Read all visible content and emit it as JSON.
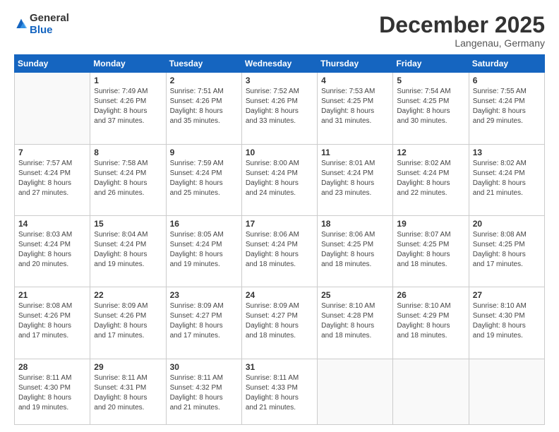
{
  "header": {
    "logo_general": "General",
    "logo_blue": "Blue",
    "month_title": "December 2025",
    "location": "Langenau, Germany"
  },
  "days_of_week": [
    "Sunday",
    "Monday",
    "Tuesday",
    "Wednesday",
    "Thursday",
    "Friday",
    "Saturday"
  ],
  "weeks": [
    [
      {
        "day": "",
        "info": ""
      },
      {
        "day": "1",
        "info": "Sunrise: 7:49 AM\nSunset: 4:26 PM\nDaylight: 8 hours\nand 37 minutes."
      },
      {
        "day": "2",
        "info": "Sunrise: 7:51 AM\nSunset: 4:26 PM\nDaylight: 8 hours\nand 35 minutes."
      },
      {
        "day": "3",
        "info": "Sunrise: 7:52 AM\nSunset: 4:26 PM\nDaylight: 8 hours\nand 33 minutes."
      },
      {
        "day": "4",
        "info": "Sunrise: 7:53 AM\nSunset: 4:25 PM\nDaylight: 8 hours\nand 31 minutes."
      },
      {
        "day": "5",
        "info": "Sunrise: 7:54 AM\nSunset: 4:25 PM\nDaylight: 8 hours\nand 30 minutes."
      },
      {
        "day": "6",
        "info": "Sunrise: 7:55 AM\nSunset: 4:24 PM\nDaylight: 8 hours\nand 29 minutes."
      }
    ],
    [
      {
        "day": "7",
        "info": "Sunrise: 7:57 AM\nSunset: 4:24 PM\nDaylight: 8 hours\nand 27 minutes."
      },
      {
        "day": "8",
        "info": "Sunrise: 7:58 AM\nSunset: 4:24 PM\nDaylight: 8 hours\nand 26 minutes."
      },
      {
        "day": "9",
        "info": "Sunrise: 7:59 AM\nSunset: 4:24 PM\nDaylight: 8 hours\nand 25 minutes."
      },
      {
        "day": "10",
        "info": "Sunrise: 8:00 AM\nSunset: 4:24 PM\nDaylight: 8 hours\nand 24 minutes."
      },
      {
        "day": "11",
        "info": "Sunrise: 8:01 AM\nSunset: 4:24 PM\nDaylight: 8 hours\nand 23 minutes."
      },
      {
        "day": "12",
        "info": "Sunrise: 8:02 AM\nSunset: 4:24 PM\nDaylight: 8 hours\nand 22 minutes."
      },
      {
        "day": "13",
        "info": "Sunrise: 8:02 AM\nSunset: 4:24 PM\nDaylight: 8 hours\nand 21 minutes."
      }
    ],
    [
      {
        "day": "14",
        "info": "Sunrise: 8:03 AM\nSunset: 4:24 PM\nDaylight: 8 hours\nand 20 minutes."
      },
      {
        "day": "15",
        "info": "Sunrise: 8:04 AM\nSunset: 4:24 PM\nDaylight: 8 hours\nand 19 minutes."
      },
      {
        "day": "16",
        "info": "Sunrise: 8:05 AM\nSunset: 4:24 PM\nDaylight: 8 hours\nand 19 minutes."
      },
      {
        "day": "17",
        "info": "Sunrise: 8:06 AM\nSunset: 4:24 PM\nDaylight: 8 hours\nand 18 minutes."
      },
      {
        "day": "18",
        "info": "Sunrise: 8:06 AM\nSunset: 4:25 PM\nDaylight: 8 hours\nand 18 minutes."
      },
      {
        "day": "19",
        "info": "Sunrise: 8:07 AM\nSunset: 4:25 PM\nDaylight: 8 hours\nand 18 minutes."
      },
      {
        "day": "20",
        "info": "Sunrise: 8:08 AM\nSunset: 4:25 PM\nDaylight: 8 hours\nand 17 minutes."
      }
    ],
    [
      {
        "day": "21",
        "info": "Sunrise: 8:08 AM\nSunset: 4:26 PM\nDaylight: 8 hours\nand 17 minutes."
      },
      {
        "day": "22",
        "info": "Sunrise: 8:09 AM\nSunset: 4:26 PM\nDaylight: 8 hours\nand 17 minutes."
      },
      {
        "day": "23",
        "info": "Sunrise: 8:09 AM\nSunset: 4:27 PM\nDaylight: 8 hours\nand 17 minutes."
      },
      {
        "day": "24",
        "info": "Sunrise: 8:09 AM\nSunset: 4:27 PM\nDaylight: 8 hours\nand 18 minutes."
      },
      {
        "day": "25",
        "info": "Sunrise: 8:10 AM\nSunset: 4:28 PM\nDaylight: 8 hours\nand 18 minutes."
      },
      {
        "day": "26",
        "info": "Sunrise: 8:10 AM\nSunset: 4:29 PM\nDaylight: 8 hours\nand 18 minutes."
      },
      {
        "day": "27",
        "info": "Sunrise: 8:10 AM\nSunset: 4:30 PM\nDaylight: 8 hours\nand 19 minutes."
      }
    ],
    [
      {
        "day": "28",
        "info": "Sunrise: 8:11 AM\nSunset: 4:30 PM\nDaylight: 8 hours\nand 19 minutes."
      },
      {
        "day": "29",
        "info": "Sunrise: 8:11 AM\nSunset: 4:31 PM\nDaylight: 8 hours\nand 20 minutes."
      },
      {
        "day": "30",
        "info": "Sunrise: 8:11 AM\nSunset: 4:32 PM\nDaylight: 8 hours\nand 21 minutes."
      },
      {
        "day": "31",
        "info": "Sunrise: 8:11 AM\nSunset: 4:33 PM\nDaylight: 8 hours\nand 21 minutes."
      },
      {
        "day": "",
        "info": ""
      },
      {
        "day": "",
        "info": ""
      },
      {
        "day": "",
        "info": ""
      }
    ]
  ]
}
